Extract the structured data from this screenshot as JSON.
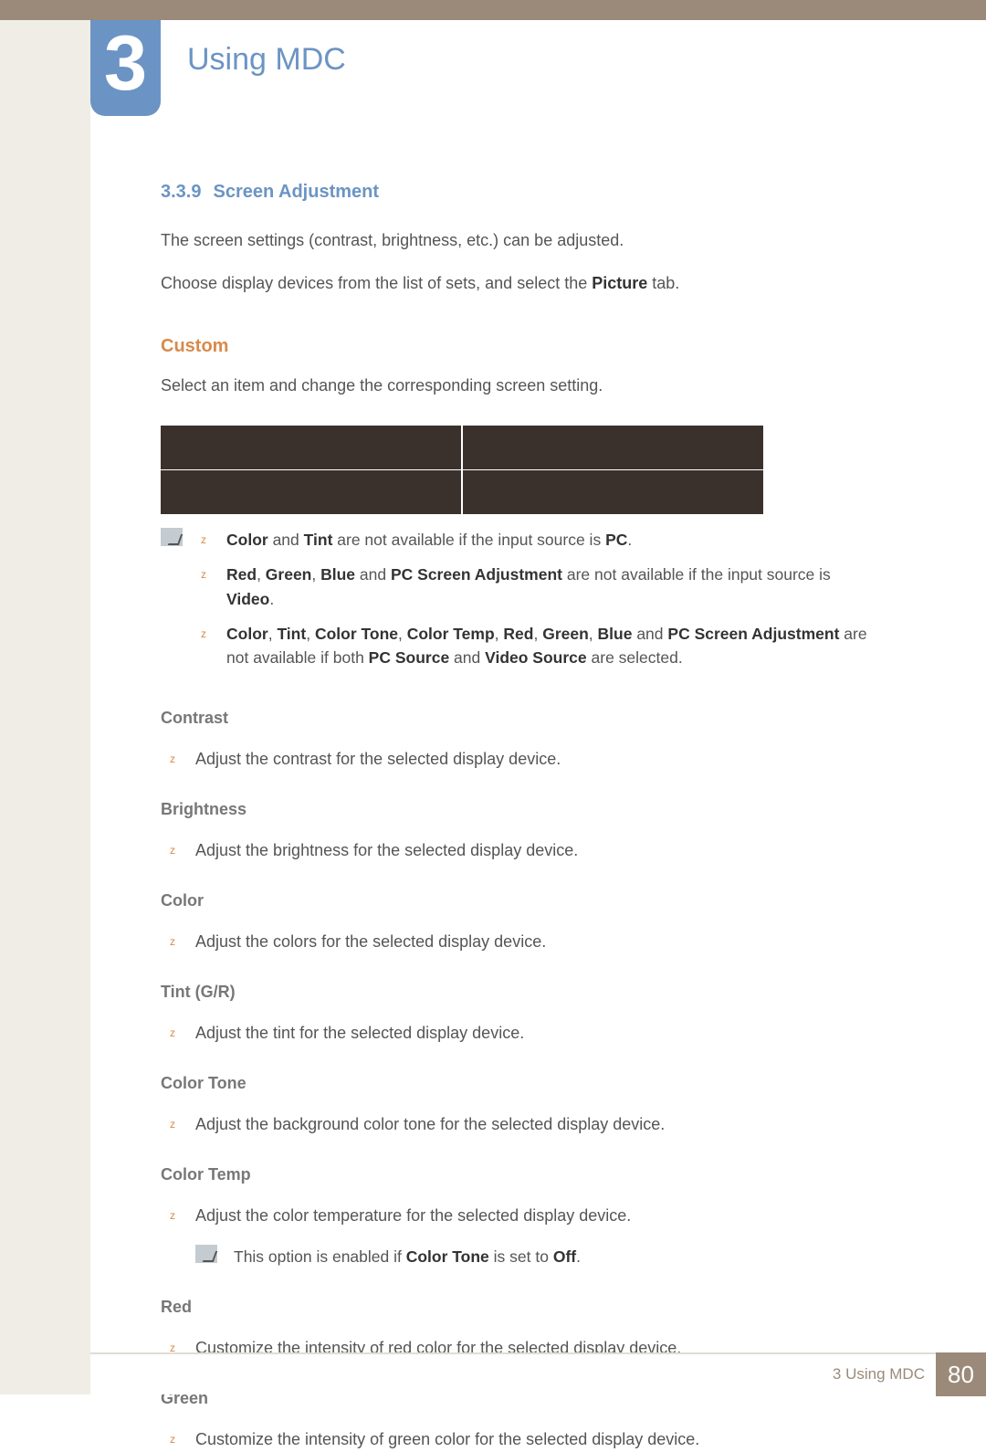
{
  "chapter": {
    "number": "3",
    "title": "Using MDC"
  },
  "section": {
    "number": "3.3.9",
    "title": "Screen Adjustment"
  },
  "intro1": "The screen settings (contrast, brightness, etc.) can be adjusted.",
  "intro2_a": "Choose display devices from the list of sets, and select the ",
  "intro2_b": "Picture",
  "intro2_c": " tab.",
  "custom": {
    "head": "Custom",
    "text": "Select an item and change the corresponding screen setting."
  },
  "notes": {
    "n1": {
      "a": "Color",
      "b": " and ",
      "c": "Tint",
      "d": " are not available if the input source is ",
      "e": "PC",
      "f": "."
    },
    "n2": {
      "a": "Red",
      "b": ", ",
      "c": "Green",
      "d": ", ",
      "e": "Blue",
      "f": " and ",
      "g": "PC Screen Adjustment",
      "h": " are not available if the input source is ",
      "i": "Video",
      "j": "."
    },
    "n3": {
      "a": "Color",
      "b": ", ",
      "c": "Tint",
      "d": ", ",
      "e": "Color Tone",
      "f": ", ",
      "g": "Color Temp",
      "h": ", ",
      "i": "Red",
      "j": ", ",
      "k": "Green",
      "l": ", ",
      "m": "Blue",
      "n": " and ",
      "o": "PC Screen Adjustment",
      "p": " are not available if both ",
      "q": "PC Source",
      "r": " and ",
      "s": "Video Source",
      "t": " are selected."
    }
  },
  "items": {
    "contrast": {
      "head": "Contrast",
      "text": "Adjust the contrast for the selected display device."
    },
    "brightness": {
      "head": "Brightness",
      "text": "Adjust the brightness for the selected display device."
    },
    "color": {
      "head": "Color",
      "text": "Adjust the colors for the selected display device."
    },
    "tint": {
      "head": "Tint (G/R)",
      "text": "Adjust the tint for the selected display device."
    },
    "colortone": {
      "head": "Color Tone",
      "text": "Adjust the background color tone for the selected display device."
    },
    "colortemp": {
      "head": "Color Temp",
      "text": "Adjust the color temperature for the selected display device.",
      "note_a": "This option is enabled if ",
      "note_b": "Color Tone",
      "note_c": " is set to ",
      "note_d": "Off",
      "note_e": "."
    },
    "red": {
      "head": "Red",
      "text": "Customize the intensity of red color for the selected display device."
    },
    "green": {
      "head": "Green",
      "text": "Customize the intensity of green color for the selected display device."
    }
  },
  "footer": {
    "text": "3 Using MDC",
    "page": "80"
  }
}
